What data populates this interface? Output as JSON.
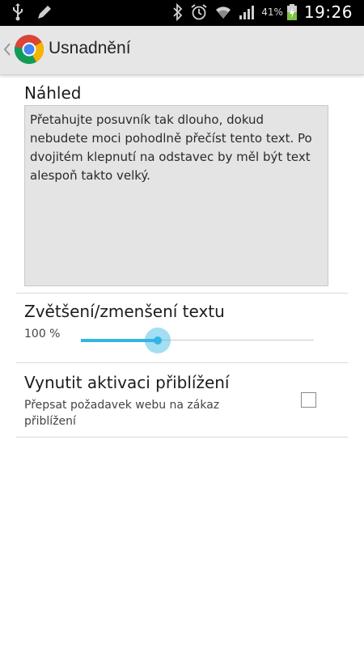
{
  "statusbar": {
    "battery_percent": "41%",
    "time": "19:26",
    "icons": [
      "usb-icon",
      "pencil-icon",
      "bluetooth-icon",
      "alarm-icon",
      "wifi-icon",
      "signal-icon",
      "battery-charging-icon"
    ]
  },
  "actionbar": {
    "title": "Usnadnění",
    "app_icon": "chrome-logo-icon"
  },
  "preview": {
    "title": "Náhled",
    "text": "Přetahujte posuvník tak dlouho, dokud nebudete moci pohodlně přečíst tento text. Po dvojitém klepnutí na odstavec by měl být text alespoň takto velký."
  },
  "text_scale": {
    "title": "Zvětšení/zmenšení textu",
    "value_label": "100 %",
    "slider_fraction": 0.33,
    "accent_color": "#33b5e5"
  },
  "force_zoom": {
    "title": "Vynutit aktivaci přiblížení",
    "summary": "Přepsat požadavek webu na zákaz přiblížení",
    "checked": false
  }
}
